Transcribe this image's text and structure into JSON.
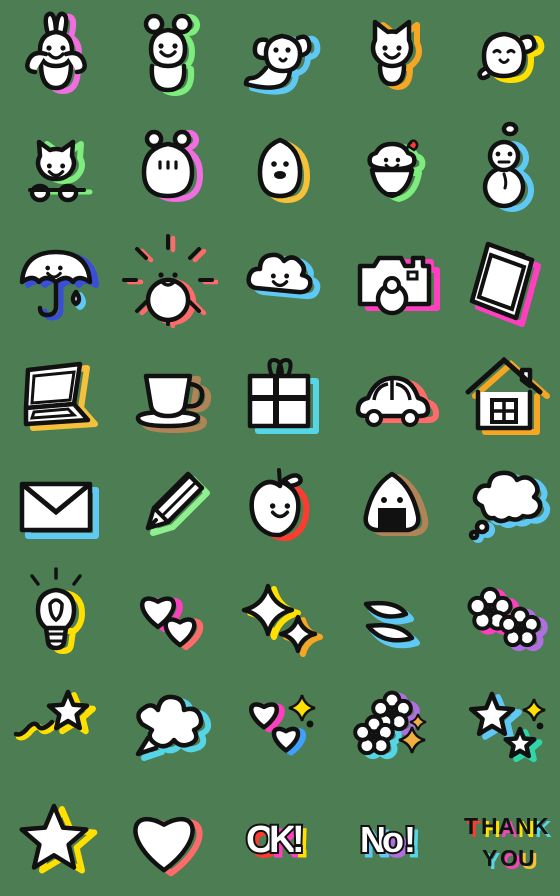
{
  "sheet": {
    "title": "Emoji sticker sheet",
    "background_color": "#4d7d53",
    "columns": 5,
    "rows": 8,
    "cell_size_px": 112,
    "style_note": "hand-drawn white line-art stickers with offset colored shadow",
    "line_color": "#111111",
    "fill_color": "#ffffff"
  },
  "palette": {
    "pink": "#f06ee0",
    "magenta": "#ff3ec0",
    "hot_pink": "#ff4fae",
    "green": "#7dee7d",
    "light_green": "#8ef08e",
    "sky": "#5fc8f5",
    "cyan": "#55d5e6",
    "blue": "#3fa0ff",
    "indigo": "#3a4fd8",
    "yellow": "#ffe000",
    "gold": "#f5c13a",
    "orange": "#f5a623",
    "amber": "#f0b040",
    "red": "#ff3b30",
    "coral": "#ff6b6b",
    "brown": "#b08457",
    "purple": "#b06fe0",
    "teal": "#2fd6a8"
  },
  "items": [
    {
      "row": 1,
      "col": 1,
      "name": "rabbit-waving",
      "label": "Rabbit waving",
      "shadow": "#f06ee0"
    },
    {
      "row": 1,
      "col": 2,
      "name": "bear-smiling",
      "label": "Bear smiling",
      "shadow": "#7dee7d"
    },
    {
      "row": 1,
      "col": 3,
      "name": "dog-waving",
      "label": "Dog waving",
      "shadow": "#5fc8f5"
    },
    {
      "row": 1,
      "col": 4,
      "name": "cat-smiling",
      "label": "Cat smiling",
      "shadow": "#f5a623"
    },
    {
      "row": 1,
      "col": 5,
      "name": "seal-winking",
      "label": "Seal winking",
      "shadow": "#ffe000"
    },
    {
      "row": 2,
      "col": 1,
      "name": "cat-peeking",
      "label": "Cat peeking",
      "shadow": "#7dee7d"
    },
    {
      "row": 2,
      "col": 2,
      "name": "hamster",
      "label": "Hamster",
      "shadow": "#f06ee0"
    },
    {
      "row": 2,
      "col": 3,
      "name": "chick-egg",
      "label": "Egg chick",
      "shadow": "#f5c13a"
    },
    {
      "row": 2,
      "col": 4,
      "name": "shaved-ice",
      "label": "Shaved ice",
      "shadow": "#7dee7d"
    },
    {
      "row": 2,
      "col": 5,
      "name": "snowman",
      "label": "Snowman",
      "shadow": "#5fc8f5"
    },
    {
      "row": 3,
      "col": 1,
      "name": "umbrella-rain",
      "label": "Umbrella with raindrop",
      "shadow": "#3a4fd8"
    },
    {
      "row": 3,
      "col": 2,
      "name": "sun-smiling",
      "label": "Smiling sun",
      "shadow": "#ff6b6b"
    },
    {
      "row": 3,
      "col": 3,
      "name": "cloud-smiling",
      "label": "Smiling cloud",
      "shadow": "#5fc8f5"
    },
    {
      "row": 3,
      "col": 4,
      "name": "camera",
      "label": "Camera",
      "shadow": "#ff3ec0"
    },
    {
      "row": 3,
      "col": 5,
      "name": "smartphone",
      "label": "Smartphone",
      "shadow": "#ff3ec0"
    },
    {
      "row": 4,
      "col": 1,
      "name": "laptop",
      "label": "Laptop",
      "shadow": "#f5c13a"
    },
    {
      "row": 4,
      "col": 2,
      "name": "coffee-cup",
      "label": "Coffee cup",
      "shadow": "#b08457"
    },
    {
      "row": 4,
      "col": 3,
      "name": "gift-box",
      "label": "Gift box",
      "shadow": "#55d5e6"
    },
    {
      "row": 4,
      "col": 4,
      "name": "car",
      "label": "Car",
      "shadow": "#ff6b6b"
    },
    {
      "row": 4,
      "col": 5,
      "name": "house",
      "label": "House",
      "shadow": "#f5a623"
    },
    {
      "row": 5,
      "col": 1,
      "name": "envelope",
      "label": "Envelope",
      "shadow": "#5fc8f5"
    },
    {
      "row": 5,
      "col": 2,
      "name": "pencil",
      "label": "Pencil",
      "shadow": "#7dee7d"
    },
    {
      "row": 5,
      "col": 3,
      "name": "apple",
      "label": "Smiling apple",
      "shadow": "#ff3b30"
    },
    {
      "row": 5,
      "col": 4,
      "name": "rice-ball",
      "label": "Rice ball onigiri",
      "shadow": "#b08457"
    },
    {
      "row": 5,
      "col": 5,
      "name": "thought-bubble",
      "label": "Thought bubble",
      "shadow": "#5fc8f5"
    },
    {
      "row": 6,
      "col": 1,
      "name": "light-bulb",
      "label": "Light bulb",
      "shadow": "#ffe000"
    },
    {
      "row": 6,
      "col": 2,
      "name": "two-hearts",
      "label": "Two hearts",
      "shadow": "#ff3ec0"
    },
    {
      "row": 6,
      "col": 3,
      "name": "sparkles",
      "label": "Sparkles",
      "shadow": "#ffe000"
    },
    {
      "row": 6,
      "col": 4,
      "name": "sweat-drops",
      "label": "Sweat drops",
      "shadow": "#5fc8f5"
    },
    {
      "row": 6,
      "col": 5,
      "name": "two-flowers",
      "label": "Two flowers",
      "shadow": "#f06ee0"
    },
    {
      "row": 7,
      "col": 1,
      "name": "shooting-star",
      "label": "Shooting star",
      "shadow": "#ffe000"
    },
    {
      "row": 7,
      "col": 2,
      "name": "speech-burst",
      "label": "Speech burst",
      "shadow": "#55d5e6"
    },
    {
      "row": 7,
      "col": 3,
      "name": "hearts-sparkle",
      "label": "Hearts with sparkle",
      "shadow": "#3fa0ff"
    },
    {
      "row": 7,
      "col": 4,
      "name": "flowers-sparkle",
      "label": "Flowers with sparkle",
      "shadow": "#b06fe0"
    },
    {
      "row": 7,
      "col": 5,
      "name": "stars-sparkle",
      "label": "Stars with sparkle",
      "shadow": "#2fd6a8"
    },
    {
      "row": 8,
      "col": 1,
      "name": "star",
      "label": "Star",
      "shadow": "#ffe000"
    },
    {
      "row": 8,
      "col": 2,
      "name": "heart",
      "label": "Heart",
      "shadow": "#ff6b6b"
    },
    {
      "row": 8,
      "col": 3,
      "name": "text-ok",
      "label": "OK!",
      "shadow": "#ff3ec0"
    },
    {
      "row": 8,
      "col": 4,
      "name": "text-no",
      "label": "No!",
      "shadow": "#5fc8f5"
    },
    {
      "row": 8,
      "col": 5,
      "name": "text-thank-you",
      "label": "THANK YOU",
      "shadow": "#ff3ec0"
    }
  ],
  "text_stickers": {
    "ok": {
      "text": "OK!",
      "letters": [
        {
          "char": "O",
          "shadow": "#ff3b30"
        },
        {
          "char": "K",
          "shadow": "#ff3ec0"
        },
        {
          "char": "!",
          "shadow": "#ffe000"
        }
      ]
    },
    "no": {
      "text": "No!",
      "letters": [
        {
          "char": "N",
          "shadow": "#5fc8f5"
        },
        {
          "char": "o",
          "shadow": "#b06fe0"
        },
        {
          "char": "!",
          "shadow": "#55d5e6"
        }
      ]
    },
    "thank_you": {
      "line1": "THANK",
      "line2": "YOU",
      "letters1": [
        {
          "char": "T",
          "shadow": "#ff3b30"
        },
        {
          "char": "H",
          "shadow": "#ffe000"
        },
        {
          "char": "A",
          "shadow": "#ff3ec0"
        },
        {
          "char": "N",
          "shadow": "#ffe000"
        },
        {
          "char": "K",
          "shadow": "#55d5e6"
        }
      ],
      "letters2": [
        {
          "char": "Y",
          "shadow": "#55d5e6"
        },
        {
          "char": "O",
          "shadow": "#ff3ec0"
        },
        {
          "char": "U",
          "shadow": "#f5c13a"
        }
      ]
    }
  }
}
